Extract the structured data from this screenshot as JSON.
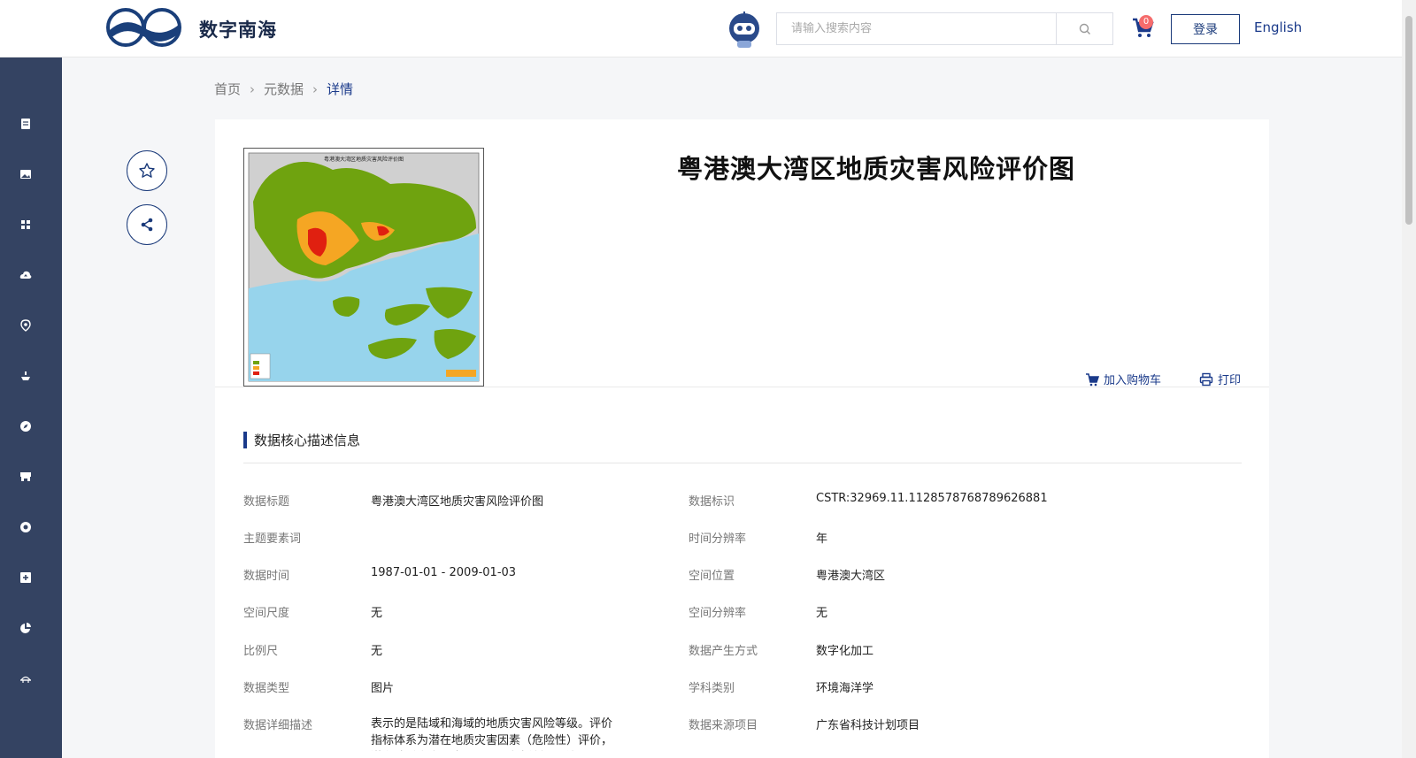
{
  "header": {
    "brand": "数字南海",
    "search_placeholder": "请输入搜索内容",
    "cart_count": "0",
    "login": "登录",
    "language": "English"
  },
  "sidebar": {
    "icons": [
      "document-icon",
      "image-icon",
      "grid-icon",
      "cloud-upload-icon",
      "location-icon",
      "ship-icon",
      "compass-icon",
      "store-icon",
      "satellite-icon",
      "add-box-icon",
      "pie-chart-icon",
      "bridge-icon"
    ]
  },
  "breadcrumb": {
    "home": "首页",
    "metadata": "元数据",
    "current": "详情"
  },
  "detail": {
    "title": "粤港澳大湾区地质灾害风险评价图",
    "map_title": "粤港澳大湾区地质灾害风险评价图",
    "add_to_cart": "加入购物车",
    "print": "打印"
  },
  "section": {
    "title": "数据核心描述信息",
    "left": [
      {
        "label": "数据标题",
        "value": "粤港澳大湾区地质灾害风险评价图"
      },
      {
        "label": "主题要素词",
        "value": ""
      },
      {
        "label": "数据时间",
        "value": "1987-01-01 - 2009-01-03"
      },
      {
        "label": "空间尺度",
        "value": "无"
      },
      {
        "label": "比例尺",
        "value": "无"
      },
      {
        "label": "数据类型",
        "value": "图片"
      },
      {
        "label": "数据详细描述",
        "value": "表示的是陆域和海域的地质灾害风险等级。评价指标体系为潜在地质灾害因素（危险性）评价，潜在地质灾害因素评价因子包括断层、浅"
      }
    ],
    "right": [
      {
        "label": "数据标识",
        "value": "CSTR:32969.11.1128578768789626881"
      },
      {
        "label": "时间分辨率",
        "value": "年"
      },
      {
        "label": "空间位置",
        "value": "粤港澳大湾区"
      },
      {
        "label": "空间分辨率",
        "value": "无"
      },
      {
        "label": "数据产生方式",
        "value": "数字化加工"
      },
      {
        "label": "学科类别",
        "value": "环境海洋学"
      },
      {
        "label": "数据来源项目",
        "value": "广东省科技计划项目"
      }
    ]
  },
  "colors": {
    "primary": "#1a3a8a",
    "sidebar": "#344362",
    "badge": "#f56c6c"
  }
}
